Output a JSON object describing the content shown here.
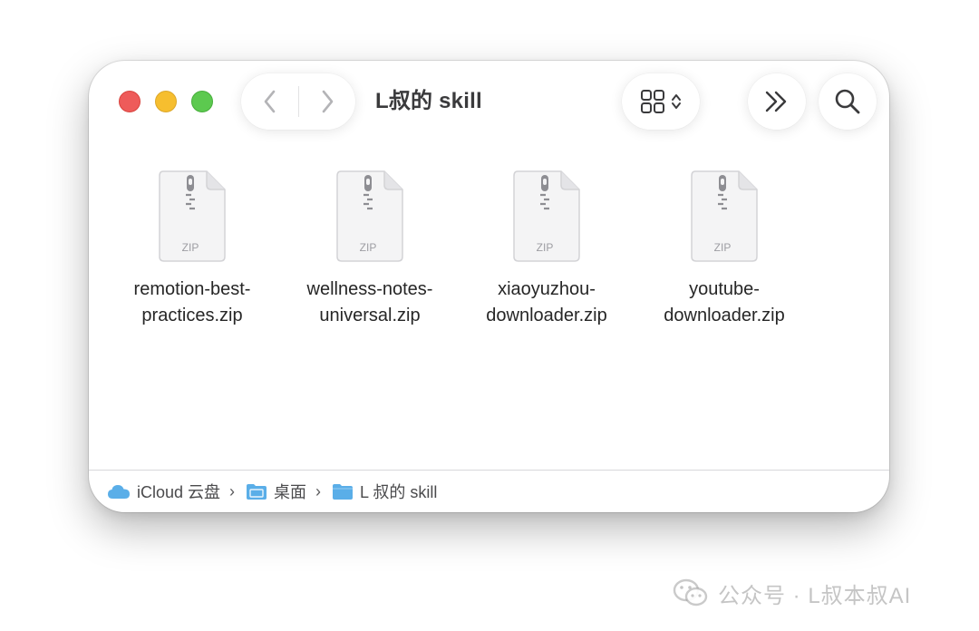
{
  "window": {
    "title": "L叔的 skill",
    "toolbar": {
      "back_icon": "chevron-left-icon",
      "forward_icon": "chevron-right-icon",
      "view_icon": "grid-view-icon",
      "more_icon": "double-chevron-right-icon",
      "search_icon": "magnifying-glass-icon"
    }
  },
  "files": [
    {
      "name": "remotion-best-\npractices.zip",
      "badge": "ZIP"
    },
    {
      "name": "wellness-notes-\nuniversal.zip",
      "badge": "ZIP"
    },
    {
      "name": "xiaoyuzhou-\ndownloader.zip",
      "badge": "ZIP"
    },
    {
      "name": "youtube-\ndownloader.zip",
      "badge": "ZIP"
    }
  ],
  "pathbar": {
    "items": [
      {
        "label": "iCloud 云盘",
        "icon": "icloud-icon"
      },
      {
        "label": "桌面",
        "icon": "folder-icon"
      },
      {
        "label": "L 叔的 skill",
        "icon": "folder-icon"
      }
    ]
  },
  "watermark": {
    "text": "公众号 · L叔本叔AI"
  },
  "colors": {
    "close": "#ee5b5a",
    "minimize": "#f6be2f",
    "zoom": "#5cc94f",
    "folder": "#5aaee8"
  }
}
